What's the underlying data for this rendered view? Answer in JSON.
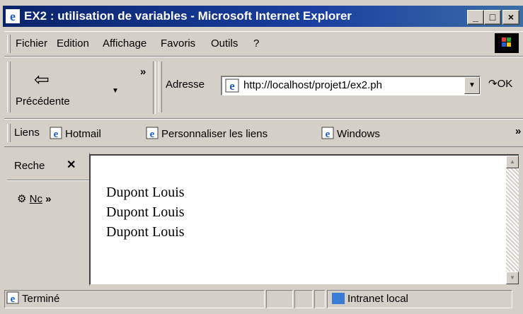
{
  "window": {
    "title": "EX2 : utilisation de variables - Microsoft Internet Explorer"
  },
  "caption_buttons": {
    "minimize": "_",
    "maximize": "□",
    "close": "×"
  },
  "menubar": {
    "items": [
      "Fichier",
      "Edition",
      "Affichage",
      "Favoris",
      "Outils",
      "?"
    ]
  },
  "toolbar": {
    "back_label": "Précédente",
    "address_label": "Adresse",
    "address_value": "http://localhost/projet1/ex2.ph",
    "ok_label": "OK"
  },
  "links": {
    "label": "Liens",
    "items": [
      "Hotmail",
      "Personnaliser les liens",
      "Windows"
    ]
  },
  "sidebar": {
    "title": "Reche",
    "new_label": "Nc"
  },
  "content": {
    "lines": [
      "Dupont Louis",
      "Dupont Louis",
      "Dupont Louis"
    ]
  },
  "status": {
    "text": "Terminé",
    "zone": "Intranet local"
  },
  "colors": {
    "titlebar_start": "#0a246a",
    "titlebar_end": "#3a6ea5",
    "chrome": "#d4d0c8"
  },
  "icons": [
    "ie-icon",
    "back-arrow-icon",
    "windows-logo-icon",
    "page-icon",
    "refresh-ok-icon",
    "search-icon",
    "intranet-icon"
  ]
}
